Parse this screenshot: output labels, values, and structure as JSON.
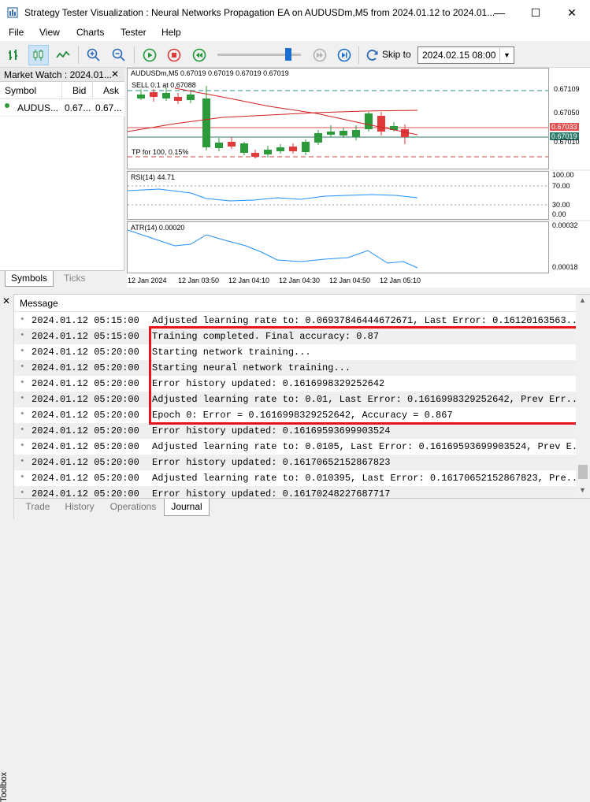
{
  "window": {
    "title": "Strategy Tester Visualization : Neural Networks Propagation EA on AUDUSDm,M5 from 2024.01.12 to 2024.01...",
    "minimize": "—",
    "maximize": "☐",
    "close": "✕"
  },
  "menu": [
    "File",
    "View",
    "Charts",
    "Tester",
    "Help"
  ],
  "toolbar": {
    "skip_to_label": "Skip to",
    "skip_to_value": "2024.02.15 08:00",
    "speed_slider_level": 0.85
  },
  "market_watch": {
    "title": "Market Watch : 2024.01...",
    "close": "✕",
    "columns": [
      "Symbol",
      "Bid",
      "Ask"
    ],
    "rows": [
      {
        "symbol": "AUDUS...",
        "bid": "0.67...",
        "ask": "0.67..."
      }
    ],
    "tabs": [
      "Symbols",
      "Ticks"
    ]
  },
  "chart": {
    "header": "AUDUSDm,M5  0.67019 0.67019 0.67019 0.67019",
    "sell_label": "SELL 0.1 at 0.67088",
    "tp_label": "TP for 100, 0.15%",
    "price_ticks": [
      "0.67109",
      "0.67050",
      "0.67010"
    ],
    "price_tags": [
      {
        "value": "0.67033",
        "color": "#e25050"
      },
      {
        "value": "0.67019",
        "color": "#2a7a6a"
      }
    ],
    "rsi_label": "RSI(14) 44.71",
    "rsi_ticks": [
      "100.00",
      "70.00",
      "30.00",
      "0.00"
    ],
    "atr_label": "ATR(14) 0.00020",
    "atr_ticks": [
      "0.00032",
      "0.00018"
    ],
    "time_ticks": [
      "12 Jan 2024",
      "12 Jan 03:50",
      "12 Jan 04:10",
      "12 Jan 04:30",
      "12 Jan 04:50",
      "12 Jan 05:10"
    ]
  },
  "colors": {
    "bull": "#2a9a3a",
    "bear": "#e03a3a",
    "ma": "#d02020",
    "indicator": "#1e90ff",
    "highlight": "#e8141c"
  },
  "toolbox": {
    "side_label": "Toolbox",
    "close": "✕",
    "column_header": "Message",
    "log": [
      {
        "time": "2024.01.12 05:15:00",
        "message": "Adjusted learning rate to: 0.06937846444672671, Last Error: 0.16120163563..."
      },
      {
        "time": "2024.01.12 05:15:00",
        "message": "Training completed. Final accuracy: 0.87"
      },
      {
        "time": "2024.01.12 05:20:00",
        "message": "Starting network training..."
      },
      {
        "time": "2024.01.12 05:20:00",
        "message": "Starting neural network training..."
      },
      {
        "time": "2024.01.12 05:20:00",
        "message": "Error history updated: 0.1616998329252642"
      },
      {
        "time": "2024.01.12 05:20:00",
        "message": "Adjusted learning rate to: 0.01, Last Error: 0.1616998329252642, Prev Err..."
      },
      {
        "time": "2024.01.12 05:20:00",
        "message": "Epoch 0: Error = 0.1616998329252642, Accuracy = 0.867"
      },
      {
        "time": "2024.01.12 05:20:00",
        "message": "Error history updated: 0.16169593699903524"
      },
      {
        "time": "2024.01.12 05:20:00",
        "message": "Adjusted learning rate to: 0.0105, Last Error: 0.16169593699903524, Prev E..."
      },
      {
        "time": "2024.01.12 05:20:00",
        "message": "Error history updated: 0.16170652152867823"
      },
      {
        "time": "2024.01.12 05:20:00",
        "message": "Adjusted learning rate to: 0.010395, Last Error: 0.16170652152867823, Pre..."
      },
      {
        "time": "2024.01.12 05:20:00",
        "message": "Error history updated: 0.16170248227687717"
      }
    ],
    "tabs": [
      "Trade",
      "History",
      "Operations",
      "Journal"
    ]
  }
}
